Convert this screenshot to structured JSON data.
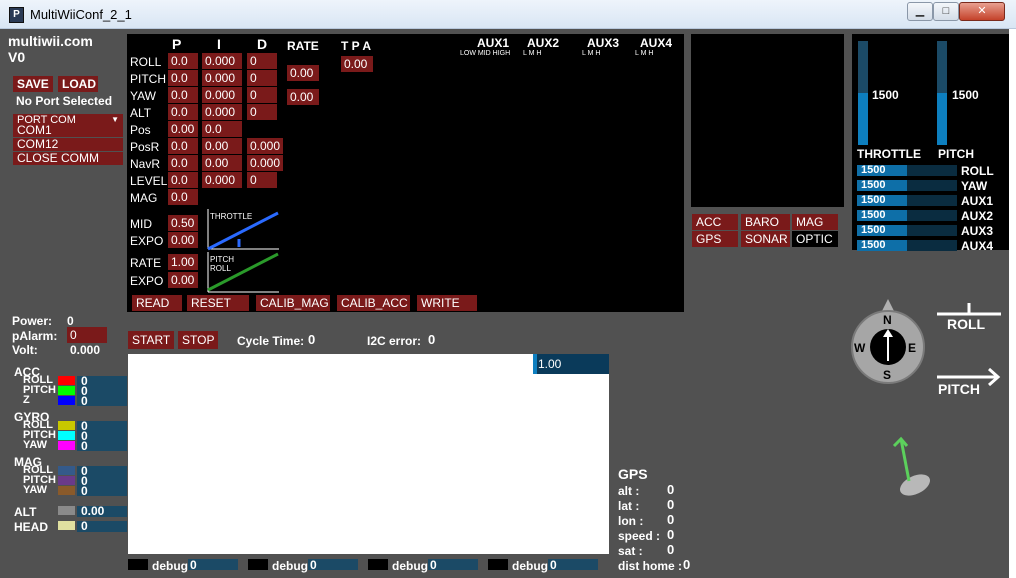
{
  "window": {
    "title": "MultiWiiConf_2_1",
    "min": "▁",
    "max": "□",
    "close": "✕"
  },
  "header": {
    "site": "multiwii.com",
    "version": "V0"
  },
  "conn": {
    "save": "SAVE",
    "load": "LOAD",
    "port_status": "No Port Selected",
    "port_com": "PORT COM",
    "ports": [
      "COM1",
      "COM12",
      "CLOSE COMM"
    ]
  },
  "pid": {
    "headers": {
      "p": "P",
      "i": "I",
      "d": "D",
      "rate": "RATE",
      "tpa": "T P A"
    },
    "rows": [
      {
        "name": "ROLL",
        "p": "0.0",
        "i": "0.000",
        "d": "0"
      },
      {
        "name": "PITCH",
        "p": "0.0",
        "i": "0.000",
        "d": "0"
      },
      {
        "name": "YAW",
        "p": "0.0",
        "i": "0.000",
        "d": "0"
      },
      {
        "name": "ALT",
        "p": "0.0",
        "i": "0.000",
        "d": "0"
      },
      {
        "name": "Pos",
        "p": "0.00",
        "i": "0.0",
        "d": ""
      },
      {
        "name": "PosR",
        "p": "0.0",
        "i": "0.00",
        "d": "0.000"
      },
      {
        "name": "NavR",
        "p": "0.0",
        "i": "0.00",
        "d": "0.000"
      },
      {
        "name": "LEVEL",
        "p": "0.0",
        "i": "0.000",
        "d": "0"
      },
      {
        "name": "MAG",
        "p": "0.0",
        "i": "",
        "d": ""
      }
    ],
    "rate_rollpitch": "0.00",
    "rate_yaw": "0.00",
    "tpa": "0.00"
  },
  "aux": {
    "labels": [
      "AUX1",
      "AUX2",
      "AUX3",
      "AUX4"
    ],
    "sub1": "LOW MID HIGH",
    "sub": "L  M  H"
  },
  "expo": {
    "mid_label": "MID",
    "mid": "0.50",
    "expo_label": "EXPO",
    "expo1": "0.00",
    "rate_label": "RATE",
    "rate": "1.00",
    "expo2": "0.00",
    "throttle_graph": "THROTTLE",
    "pitch_graph": "PITCH",
    "roll_graph": "ROLL"
  },
  "actions": {
    "read": "READ",
    "reset": "RESET",
    "calib_mag": "CALIB_MAG",
    "calib_acc": "CALIB_ACC",
    "write": "WRITE"
  },
  "sensors": {
    "acc": "ACC",
    "baro": "BARO",
    "mag": "MAG",
    "gps": "GPS",
    "sonar": "SONAR",
    "optic": "OPTIC"
  },
  "rc": {
    "throttle_label": "THROTTLE",
    "pitch_label": "PITCH",
    "throttle": "1500",
    "pitch": "1500",
    "throttle_level": 0.5,
    "pitch_level": 0.5,
    "channels": [
      {
        "name": "ROLL",
        "value": "1500",
        "level": 0.5
      },
      {
        "name": "YAW",
        "value": "1500",
        "level": 0.5
      },
      {
        "name": "AUX1",
        "value": "1500",
        "level": 0.5
      },
      {
        "name": "AUX2",
        "value": "1500",
        "level": 0.5
      },
      {
        "name": "AUX3",
        "value": "1500",
        "level": 0.5
      },
      {
        "name": "AUX4",
        "value": "1500",
        "level": 0.5
      }
    ]
  },
  "power": {
    "power_label": "Power:",
    "power": "0",
    "palarm_label": "pAlarm:",
    "palarm": "0",
    "volt_label": "Volt:",
    "volt": "0.000"
  },
  "graph_ctrl": {
    "start": "START",
    "stop": "STOP",
    "cycle_label": "Cycle Time:",
    "cycle": "0",
    "i2c_label": "I2C error:",
    "i2c": "0",
    "scale": "1.00"
  },
  "sensor_list": {
    "acc": {
      "label": "ACC",
      "items": [
        {
          "name": "ROLL",
          "value": "0",
          "color": "#ff0000"
        },
        {
          "name": "PITCH",
          "value": "0",
          "color": "#00ff00"
        },
        {
          "name": "Z",
          "value": "0",
          "color": "#0000ff"
        }
      ]
    },
    "gyro": {
      "label": "GYRO",
      "items": [
        {
          "name": "ROLL",
          "value": "0",
          "color": "#c8c800"
        },
        {
          "name": "PITCH",
          "value": "0",
          "color": "#00ffff"
        },
        {
          "name": "YAW",
          "value": "0",
          "color": "#ff00ff"
        }
      ]
    },
    "mag": {
      "label": "MAG",
      "items": [
        {
          "name": "ROLL",
          "value": "0",
          "color": "#345a8a"
        },
        {
          "name": "PITCH",
          "value": "0",
          "color": "#6a3a8a"
        },
        {
          "name": "YAW",
          "value": "0",
          "color": "#8a5a2a"
        }
      ]
    },
    "alt": {
      "label": "ALT",
      "value": "0.00",
      "color": "#8a8a8a"
    },
    "head": {
      "label": "HEAD",
      "value": "0",
      "color": "#e0e0a0"
    }
  },
  "debug": [
    {
      "label": "debug",
      "value": "0"
    },
    {
      "label": "debug",
      "value": "0"
    },
    {
      "label": "debug",
      "value": "0"
    },
    {
      "label": "debug",
      "value": "0"
    }
  ],
  "gps": {
    "title": "GPS",
    "rows": [
      {
        "label": "alt  :",
        "value": "0"
      },
      {
        "label": "lat  :",
        "value": "0"
      },
      {
        "label": "lon  :",
        "value": "0"
      },
      {
        "label": "speed :",
        "value": "0"
      },
      {
        "label": "sat   :",
        "value": "0"
      },
      {
        "label": "dist home :",
        "value": "0"
      }
    ]
  },
  "compass": {
    "n": "N",
    "e": "E",
    "s": "S",
    "w": "W"
  },
  "attitude": {
    "roll": "ROLL",
    "pitch": "PITCH"
  }
}
